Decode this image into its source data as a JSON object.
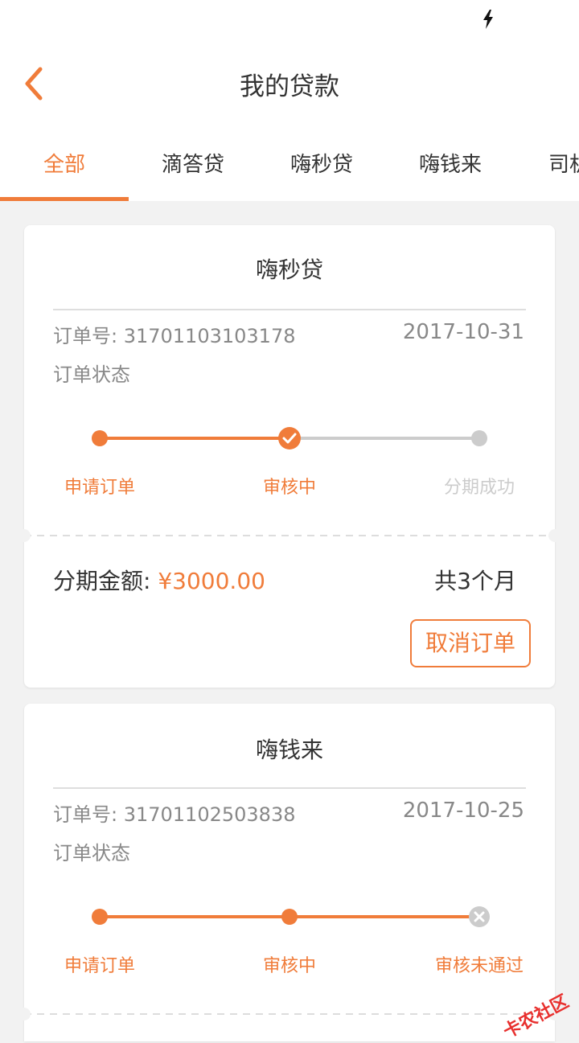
{
  "header": {
    "title": "我的贷款"
  },
  "tabs": [
    {
      "label": "全部",
      "active": true
    },
    {
      "label": "滴答贷",
      "active": false
    },
    {
      "label": "嗨秒贷",
      "active": false
    },
    {
      "label": "嗨钱来",
      "active": false
    },
    {
      "label": "司机",
      "active": false
    }
  ],
  "orders": [
    {
      "title": "嗨秒贷",
      "order_no_label": "订单号: 31701103103178",
      "date": "2017-10-31",
      "status_label": "订单状态",
      "steps": [
        {
          "label": "申请订单",
          "state": "done"
        },
        {
          "label": "审核中",
          "state": "current"
        },
        {
          "label": "分期成功",
          "state": "pending"
        }
      ],
      "amount_label": "分期金额: ",
      "amount_value": "¥3000.00",
      "term": "共3个月",
      "cancel_label": "取消订单"
    },
    {
      "title": "嗨钱来",
      "order_no_label": "订单号: 31701102503838",
      "date": "2017-10-25",
      "status_label": "订单状态",
      "steps": [
        {
          "label": "申请订单",
          "state": "done"
        },
        {
          "label": "审核中",
          "state": "done"
        },
        {
          "label": "审核未通过",
          "state": "rejected"
        }
      ]
    }
  ],
  "watermark": {
    "text": "卡农社区"
  },
  "colors": {
    "accent": "#f07c3a",
    "inactive": "#cccccc",
    "text": "#333333",
    "muted": "#888888"
  }
}
